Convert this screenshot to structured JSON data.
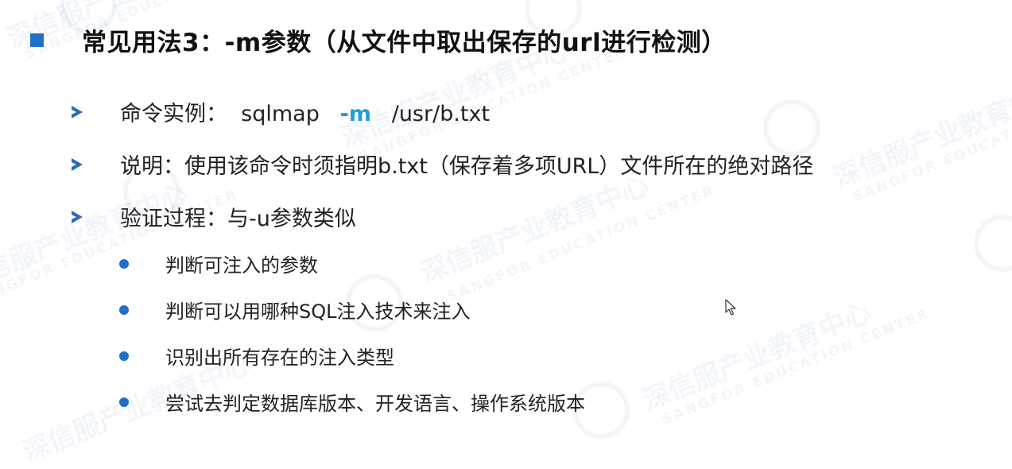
{
  "slide": {
    "title": "常见用法3：-m参数（从文件中取出保存的url进行检测）",
    "bullets": [
      {
        "label": "命令实例：",
        "command_pre": "sqlmap",
        "command_flag": "-m",
        "command_post": "/usr/b.txt"
      },
      {
        "text": "说明：使用该命令时须指明b.txt（保存着多项URL）文件所在的绝对路径"
      },
      {
        "text": "验证过程：与-u参数类似",
        "subitems": [
          "判断可注入的参数",
          "判断可以用哪种SQL注入技术来注入",
          "识别出所有存在的注入类型",
          "尝试去判定数据库版本、开发语言、操作系统版本"
        ]
      }
    ]
  },
  "watermark": {
    "cn": "深信服产业教育中心",
    "en": "SANGFOR EDUCATION CENTER"
  },
  "colors": {
    "accent": "#1f6fc6",
    "flag": "#1f9fd8",
    "text": "#222222"
  },
  "icons": {
    "title_marker": "square-bullet-icon",
    "level1_marker": "arrow-bullet-icon",
    "level2_marker": "dot-bullet-icon",
    "cursor": "mouse-pointer-icon"
  }
}
